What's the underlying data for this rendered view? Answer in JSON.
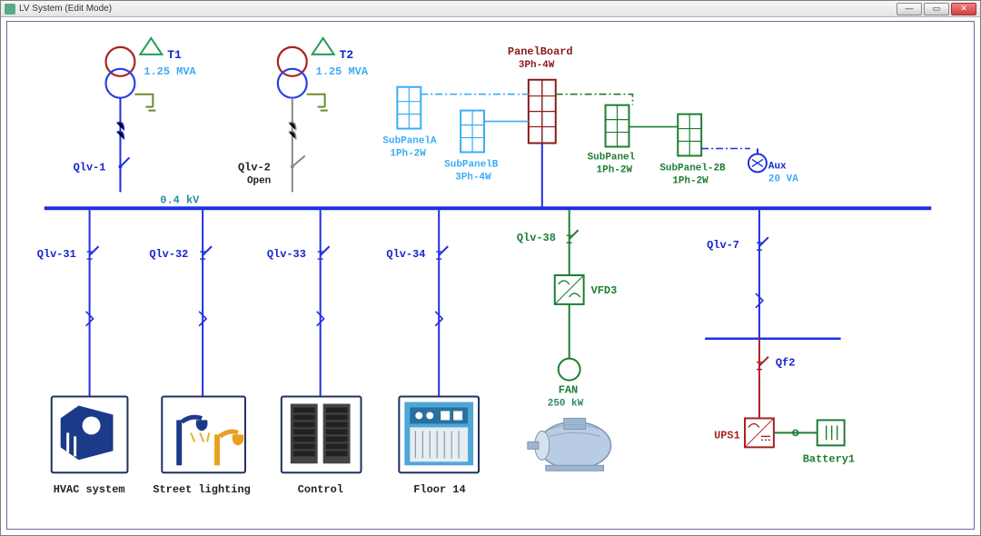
{
  "window": {
    "title": "LV System (Edit Mode)"
  },
  "transformers": {
    "t1": {
      "name": "T1",
      "rating": "1.25 MVA"
    },
    "t2": {
      "name": "T2",
      "rating": "1.25 MVA"
    }
  },
  "bus": {
    "voltage": "0.4 kV"
  },
  "breakers": {
    "qlv1": "Qlv-1",
    "qlv2": "Qlv-2",
    "qlv2_state": "Open",
    "qlv31": "Qlv-31",
    "qlv32": "Qlv-32",
    "qlv33": "Qlv-33",
    "qlv34": "Qlv-34",
    "qlv38": "Qlv-38",
    "qlv7": "Qlv-7",
    "qf2": "Qf2"
  },
  "panels": {
    "main": {
      "name": "PanelBoard",
      "type": "3Ph-4W"
    },
    "subA": {
      "name": "SubPanelA",
      "type": "1Ph-2W"
    },
    "subB": {
      "name": "SubPanelB",
      "type": "3Ph-4W"
    },
    "sub1": {
      "name": "SubPanel",
      "type": "1Ph-2W"
    },
    "sub2b": {
      "name": "SubPanel-2B",
      "type": "1Ph-2W"
    },
    "aux": {
      "name": "Aux",
      "rating": "20 VA"
    }
  },
  "drives": {
    "vfd3": "VFD3"
  },
  "loads": {
    "fan": {
      "name": "FAN",
      "rating": "250 kW"
    },
    "ups": {
      "name": "UPS1"
    },
    "battery": {
      "name": "Battery1"
    },
    "hvac": "HVAC system",
    "street": "Street lighting",
    "control": "Control",
    "floor14": "Floor 14"
  }
}
